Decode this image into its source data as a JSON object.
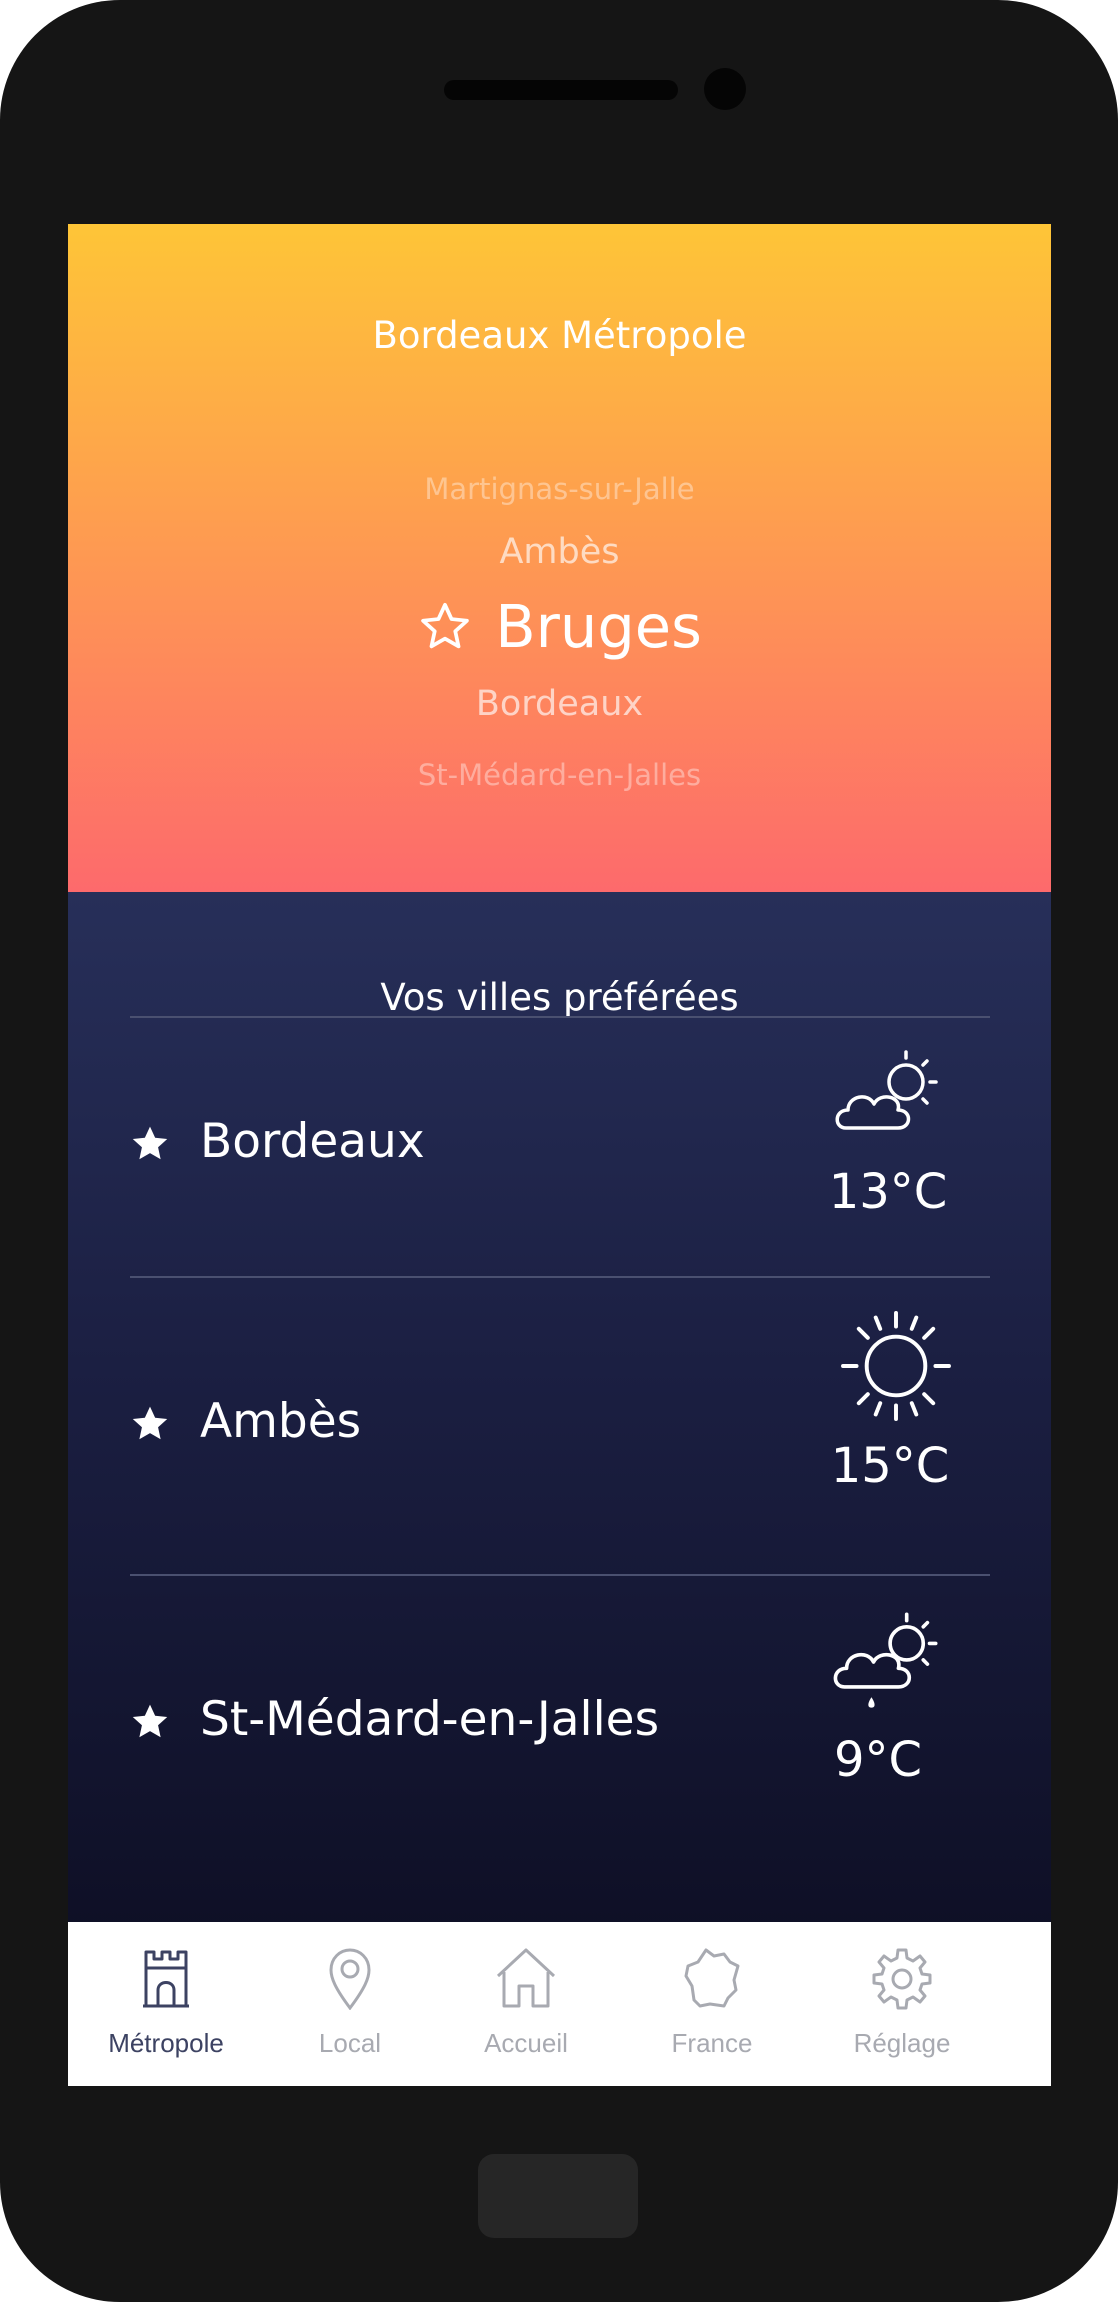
{
  "header": {
    "title": "Bordeaux Métropole"
  },
  "city_picker": {
    "items": [
      "Martignas-sur-Jalle",
      "Ambès",
      "Bruges",
      "Bordeaux",
      "St-Médard-en-Jalles"
    ],
    "selected": "Bruges",
    "selected_icon": "star-outline-icon"
  },
  "favorites": {
    "title": "Vos villes préférées",
    "items": [
      {
        "name": "Bordeaux",
        "weather_icon": "partly-cloudy-icon",
        "temperature": "13°C"
      },
      {
        "name": "Ambès",
        "weather_icon": "sunny-icon",
        "temperature": "15°C"
      },
      {
        "name": "St-Médard-en-Jalles",
        "weather_icon": "cloud-sun-rain-icon",
        "temperature": "9°C"
      }
    ]
  },
  "nav": {
    "items": [
      {
        "label": "Métropole",
        "icon": "castle-tower-icon",
        "active": true
      },
      {
        "label": "Local",
        "icon": "location-pin-icon",
        "active": false
      },
      {
        "label": "Accueil",
        "icon": "home-icon",
        "active": false
      },
      {
        "label": "France",
        "icon": "france-map-icon",
        "active": false
      },
      {
        "label": "Réglage",
        "icon": "gear-icon",
        "active": false
      }
    ]
  },
  "colors": {
    "gradient_top": "#fec537",
    "gradient_bottom": "#fd6a6c",
    "panel_top": "#272f59",
    "panel_bottom": "#0e0f25",
    "nav_active": "#3c4262",
    "nav_inactive": "#a8aab1"
  }
}
